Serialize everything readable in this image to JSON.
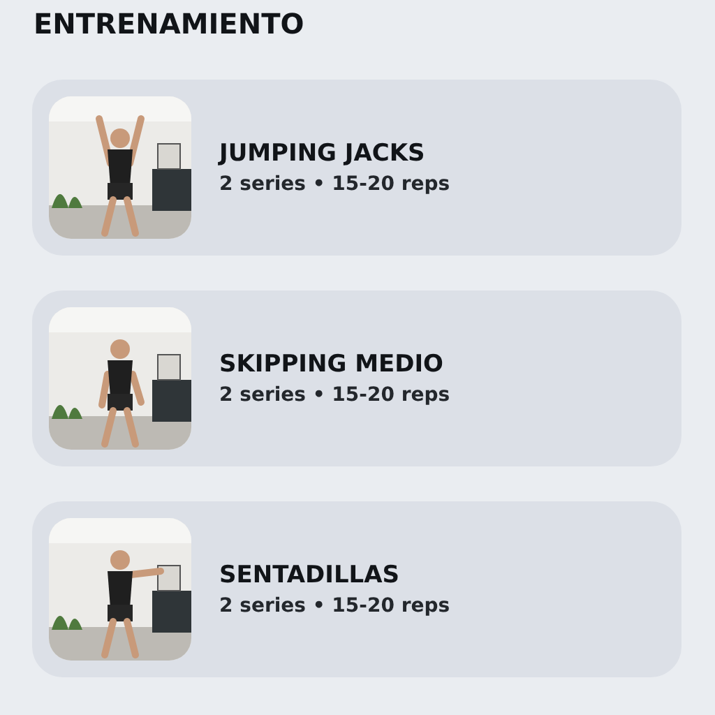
{
  "section_title": "ENTRENAMIENTO",
  "exercises": [
    {
      "name": "JUMPING JACKS",
      "detail": "2 series • 15-20 reps"
    },
    {
      "name": "SKIPPING MEDIO",
      "detail": "2 series • 15-20 reps"
    },
    {
      "name": "SENTADILLAS",
      "detail": "2 series • 15-20 reps"
    }
  ]
}
